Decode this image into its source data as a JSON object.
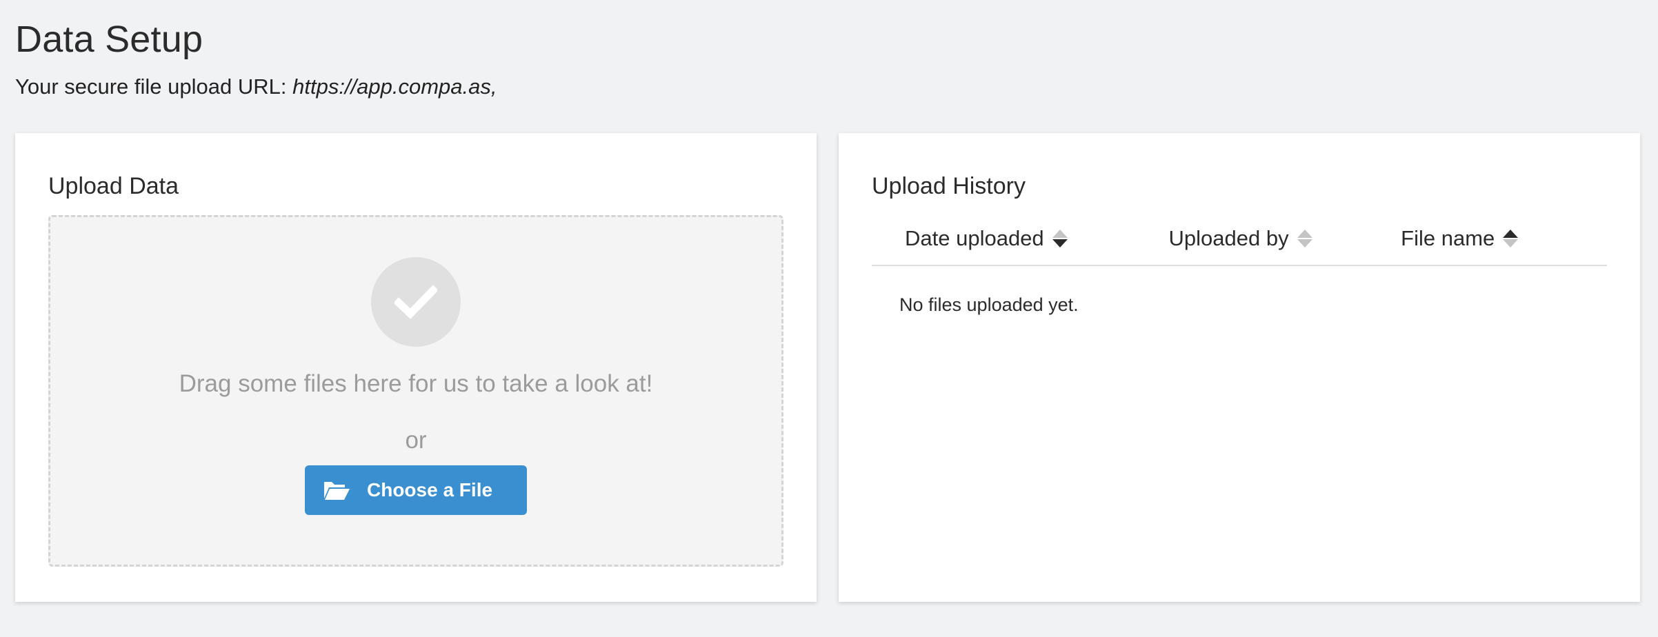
{
  "page": {
    "title": "Data Setup",
    "url_label": "Your secure file upload URL:",
    "url_value": "https://app.compa.as,"
  },
  "upload_card": {
    "title": "Upload Data",
    "drop_text": "Drag some files here for us to take a look at!",
    "or_text": "or",
    "choose_button_label": "Choose a File",
    "icons": [
      "check-icon",
      "folder-open-icon"
    ]
  },
  "history_card": {
    "title": "Upload History",
    "columns": [
      {
        "label": "Date uploaded",
        "sort": "desc"
      },
      {
        "label": "Uploaded by",
        "sort": "none"
      },
      {
        "label": "File name",
        "sort": "asc-desc"
      }
    ],
    "empty_text": "No files uploaded yet."
  },
  "colors": {
    "accent": "#3a8fd0",
    "background": "#f1f2f4",
    "muted_text": "#9b9b9b"
  }
}
